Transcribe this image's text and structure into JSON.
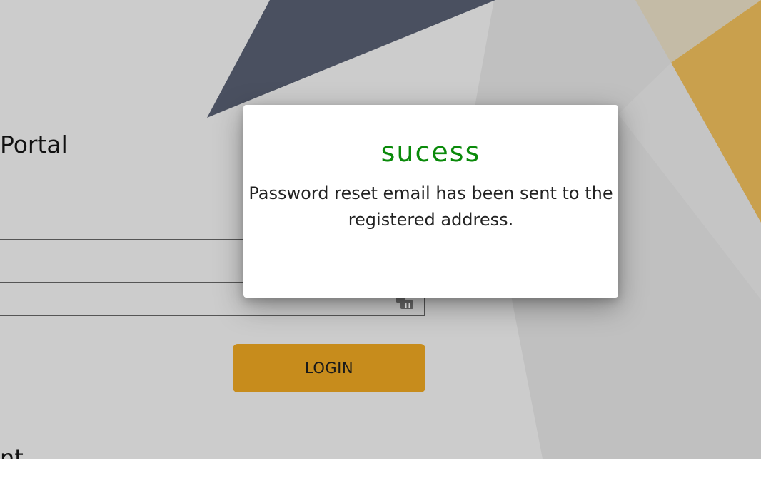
{
  "login": {
    "title": "Portal",
    "login_button_label": "LOGIN",
    "footer_partial_text": "nt"
  },
  "modal": {
    "title": "sucess",
    "message": "Password reset email has been sent to the registered address."
  },
  "colors": {
    "background": "#cccccc",
    "accent_gold": "#c78c1c",
    "shape_navy": "#4a5060",
    "shape_gold": "#c9a04d",
    "success_green": "#0a8a0a"
  }
}
